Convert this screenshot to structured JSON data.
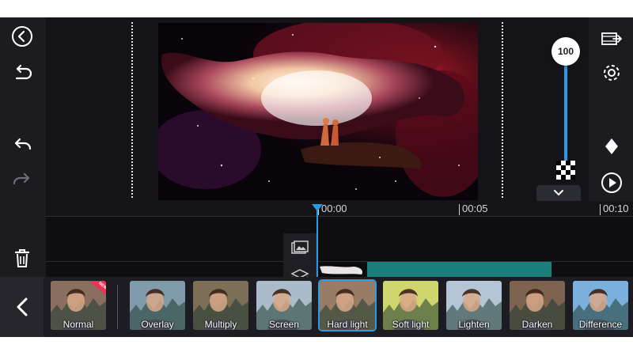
{
  "left_toolbar": {
    "icons": [
      "back-circle-icon",
      "return-icon",
      "undo-icon",
      "redo-icon",
      "trash-icon"
    ]
  },
  "right_toolbar": {
    "icons": [
      "export-icon",
      "gear-icon",
      "keyframe-diamond-icon",
      "play-icon"
    ]
  },
  "opacity": {
    "value": "100",
    "level": 1.0
  },
  "timeline": {
    "ticks": [
      "00:00",
      "00:05",
      "00:10"
    ],
    "layer_count": "1",
    "track_icons": [
      "image-track-icon",
      "layers-icon"
    ]
  },
  "blend_modes": [
    {
      "label": "Normal",
      "tint": "#7a5a4a",
      "badge": "NEW"
    },
    {
      "label": "Overlay",
      "tint": "#6f8fa0"
    },
    {
      "label": "Multiply",
      "tint": "#6a5a40"
    },
    {
      "label": "Screen",
      "tint": "#9fb3c2"
    },
    {
      "label": "Hard light",
      "tint": "#8a6a50",
      "selected": true
    },
    {
      "label": "Soft light",
      "tint": "#c9d15a"
    },
    {
      "label": "Lighten",
      "tint": "#aabed0"
    },
    {
      "label": "Darken",
      "tint": "#6c4e38"
    },
    {
      "label": "Difference",
      "tint": "#6aa6d8"
    }
  ],
  "colors": {
    "accent": "#2a9ae2",
    "clip": "#1b7f7b",
    "background": "#0f0f12",
    "badge": "#e8325a"
  }
}
